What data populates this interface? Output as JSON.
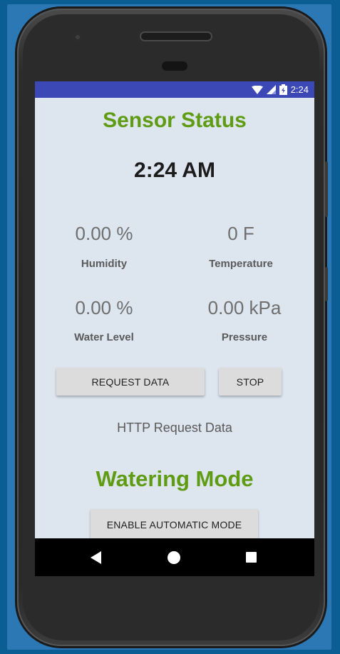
{
  "status_bar": {
    "time": "2:24",
    "icons": [
      "wifi-icon",
      "cell-signal-icon",
      "battery-charging-icon"
    ]
  },
  "app": {
    "title": "Sensor Status",
    "clock": "2:24 AM",
    "readings": {
      "humidity": {
        "value": "0.00 %",
        "label": "Humidity"
      },
      "temperature": {
        "value": "0 F",
        "label": "Temperature"
      },
      "water_level": {
        "value": "0.00 %",
        "label": "Water Level"
      },
      "pressure": {
        "value": "0.00 kPa",
        "label": "Pressure"
      }
    },
    "buttons": {
      "request": "REQUEST DATA",
      "stop": "STOP",
      "automatic": "ENABLE AUTOMATIC MODE"
    },
    "http_text": "HTTP Request Data",
    "watering_title": "Watering Mode"
  },
  "nav_bar": {
    "icons": [
      "back-icon",
      "home-icon",
      "recents-icon"
    ]
  },
  "colors": {
    "accent_green": "#5f9c14",
    "status_bar": "#3b48b5",
    "screen_background": "#dde5ef",
    "button": "#dcdcdc"
  }
}
